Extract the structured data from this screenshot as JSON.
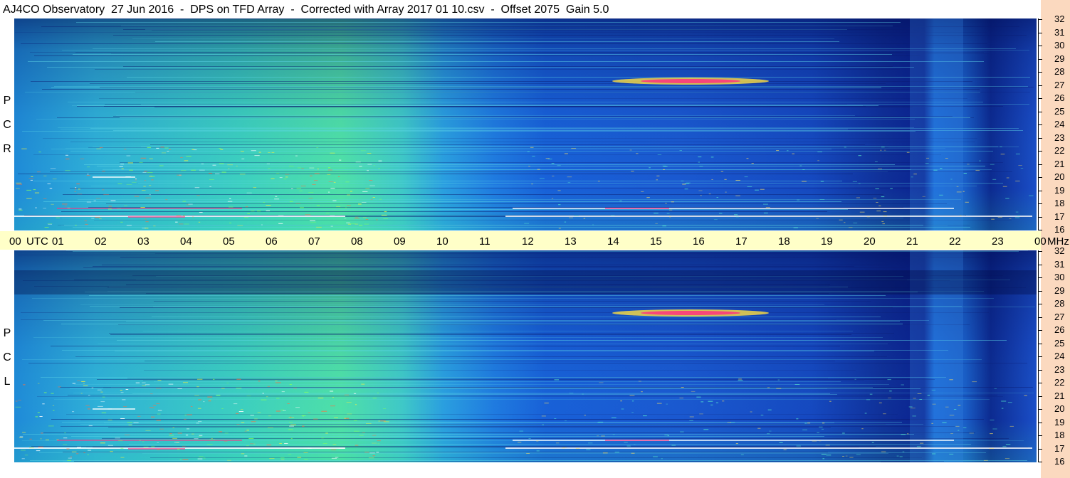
{
  "header": {
    "title": "AJ4CO Observatory  27 Jun 2016  -  DPS on TFD Array  -  Corrected with Array 2017 01 10.csv  -  Offset 2075  Gain 5.0"
  },
  "panels": {
    "rcp": {
      "letters": [
        "R",
        "C",
        "P"
      ]
    },
    "lcp": {
      "letters": [
        "L",
        "C",
        "P"
      ]
    }
  },
  "time_axis": {
    "hours": [
      "00",
      "01",
      "02",
      "03",
      "04",
      "05",
      "06",
      "07",
      "08",
      "09",
      "10",
      "11",
      "12",
      "13",
      "14",
      "15",
      "16",
      "17",
      "18",
      "19",
      "20",
      "21",
      "22",
      "23",
      "00"
    ],
    "utc_label": "UTC",
    "unit_label": "MHz"
  },
  "freq_axis": {
    "labels": [
      "32",
      "31",
      "30",
      "29",
      "28",
      "27",
      "26",
      "25",
      "24",
      "23",
      "22",
      "21",
      "20",
      "19",
      "18",
      "17",
      "16"
    ]
  },
  "colors": {
    "background": "#ffffff",
    "axis_strip": "#ffffc8",
    "side_strip": "#fbd9bf",
    "spectrogram_low": "#0a1a70",
    "spectrogram_mid": "#1a6ae0",
    "spectrogram_high": "#40e0a0",
    "burst": "#ff3080"
  }
}
